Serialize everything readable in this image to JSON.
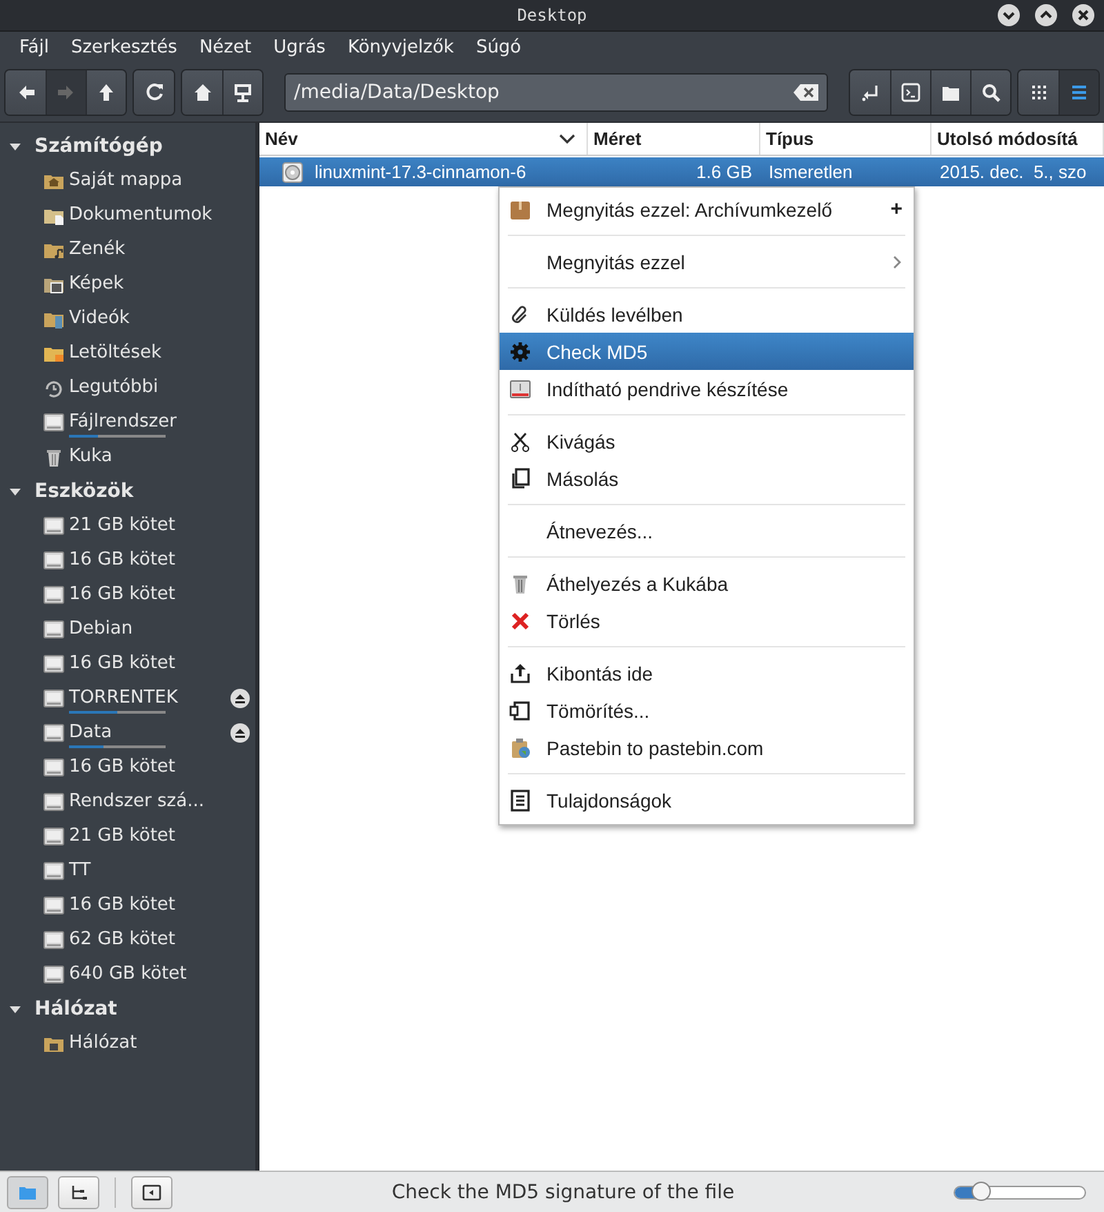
{
  "window": {
    "title": "Desktop"
  },
  "menubar": [
    "Fájl",
    "Szerkesztés",
    "Nézet",
    "Ugrás",
    "Könyvjelzők",
    "Súgó"
  ],
  "toolbar": {
    "nav_buttons": [
      {
        "kind": "back",
        "disabled": false
      },
      {
        "kind": "forward",
        "disabled": true
      },
      {
        "kind": "up",
        "disabled": false
      },
      {
        "kind": "reload",
        "disabled": false
      },
      {
        "kind": "home",
        "disabled": false
      },
      {
        "kind": "computer",
        "disabled": false
      }
    ],
    "location": "/media/Data/Desktop",
    "tool_buttons": [
      {
        "kind": "toggle"
      },
      {
        "kind": "terminal"
      },
      {
        "kind": "folder"
      },
      {
        "kind": "search"
      }
    ],
    "view_buttons": [
      {
        "kind": "icons",
        "selected": false
      },
      {
        "kind": "list",
        "selected": true
      }
    ]
  },
  "sidebar": [
    {
      "heading": "Számítógép",
      "expanded": true,
      "items": [
        {
          "kind": "home",
          "label": "Saját mappa"
        },
        {
          "kind": "documents",
          "label": "Dokumentumok"
        },
        {
          "kind": "music",
          "label": "Zenék"
        },
        {
          "kind": "pictures",
          "label": "Képek"
        },
        {
          "kind": "videos",
          "label": "Videók"
        },
        {
          "kind": "downloads",
          "label": "Letöltések"
        },
        {
          "kind": "recent",
          "label": "Legutóbbi"
        },
        {
          "kind": "drive",
          "label": "Fájlrendszer",
          "level": 0.3
        },
        {
          "kind": "trash",
          "label": "Kuka"
        }
      ]
    },
    {
      "heading": "Eszközök",
      "expanded": true,
      "items": [
        {
          "kind": "drive",
          "label": "21 GB kötet"
        },
        {
          "kind": "drive",
          "label": "16 GB kötet"
        },
        {
          "kind": "drive",
          "label": "16 GB kötet"
        },
        {
          "kind": "drive",
          "label": "Debian"
        },
        {
          "kind": "drive",
          "label": "16 GB kötet"
        },
        {
          "kind": "drive",
          "label": "TORRENTEK",
          "level": 0.5,
          "ejectable": true
        },
        {
          "kind": "drive",
          "label": "Data",
          "level": 0.36,
          "ejectable": true
        },
        {
          "kind": "drive",
          "label": "16 GB kötet"
        },
        {
          "kind": "drive",
          "label": "Rendszer szá..."
        },
        {
          "kind": "drive",
          "label": "21 GB kötet"
        },
        {
          "kind": "drive",
          "label": "TT"
        },
        {
          "kind": "drive",
          "label": "16 GB kötet"
        },
        {
          "kind": "drive",
          "label": "62 GB kötet"
        },
        {
          "kind": "drive",
          "label": "640 GB kötet"
        }
      ]
    },
    {
      "heading": "Hálózat",
      "expanded": true,
      "items": [
        {
          "kind": "network",
          "label": "Hálózat"
        }
      ]
    }
  ],
  "table": {
    "columns": [
      {
        "label": "Név",
        "sorted": true
      },
      {
        "label": "Méret",
        "sorted": false
      },
      {
        "label": "Típus",
        "sorted": false
      },
      {
        "label": "Utolsó módosítá",
        "sorted": false
      }
    ],
    "rows": [
      {
        "name": "linuxmint-17.3-cinnamon-6",
        "size": "1.6 GB",
        "type": "Ismeretlen",
        "modified": "2015. dec.  5., szo",
        "selected": true
      }
    ]
  },
  "context_menu": [
    {
      "kind": "package",
      "label": "Megnyitás ezzel: Archívumkezelő",
      "accessory": "+",
      "selected": false
    },
    {
      "kind": "separator"
    },
    {
      "kind": "plain",
      "label": "Megnyitás ezzel",
      "submenu": true,
      "selected": false
    },
    {
      "kind": "separator"
    },
    {
      "kind": "paperclip",
      "label": "Küldés levélben",
      "selected": false
    },
    {
      "kind": "gear",
      "label": "Check MD5",
      "selected": true
    },
    {
      "kind": "usb",
      "label": "Indítható pendrive készítése",
      "selected": false
    },
    {
      "kind": "separator"
    },
    {
      "kind": "scissors",
      "label": "Kivágás",
      "selected": false
    },
    {
      "kind": "copy",
      "label": "Másolás",
      "selected": false
    },
    {
      "kind": "separator"
    },
    {
      "kind": "plain",
      "label": "Átnevezés...",
      "selected": false
    },
    {
      "kind": "separator"
    },
    {
      "kind": "trash",
      "label": "Áthelyezés a Kukába",
      "selected": false
    },
    {
      "kind": "cross",
      "label": "Törlés",
      "selected": false
    },
    {
      "kind": "separator"
    },
    {
      "kind": "extract",
      "label": "Kibontás ide",
      "selected": false
    },
    {
      "kind": "compress",
      "label": "Tömörítés...",
      "selected": false
    },
    {
      "kind": "clipboard",
      "label": "Pastebin to pastebin.com",
      "selected": false
    },
    {
      "kind": "separator"
    },
    {
      "kind": "properties",
      "label": "Tulajdonságok",
      "selected": false
    }
  ],
  "status_bar": {
    "pane_buttons": [
      {
        "kind": "places",
        "selected": true
      },
      {
        "kind": "tree",
        "selected": false
      }
    ],
    "text": "Check the MD5 signature of the file",
    "zoom": {
      "level": 0.2
    }
  }
}
